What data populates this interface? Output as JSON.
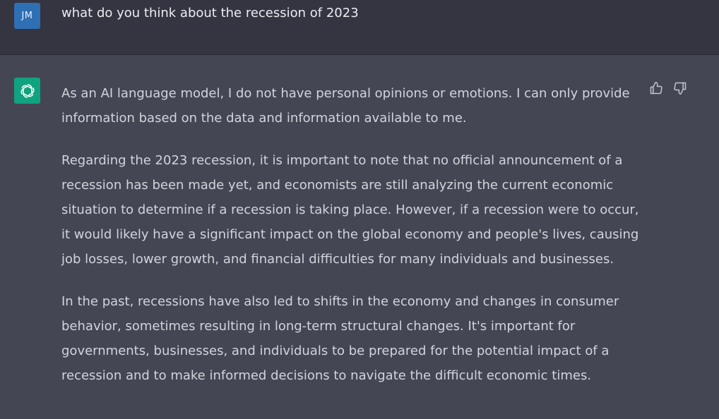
{
  "user_message": {
    "avatar_initials": "JM",
    "avatar_color": "#2f6fb3",
    "text": "what do you think about the recession of 2023"
  },
  "assistant_message": {
    "avatar_icon": "openai-logo-icon",
    "avatar_color": "#10a37f",
    "paragraphs": [
      "As an AI language model, I do not have personal opinions or emotions. I can only provide information based on the data and information available to me.",
      "Regarding the 2023 recession, it is important to note that no official announcement of a recession has been made yet, and economists are still analyzing the current economic situation to determine if a recession is taking place. However, if a recession were to occur, it would likely have a significant impact on the global economy and people's lives, causing job losses, lower growth, and financial difficulties for many individuals and businesses.",
      "In the past, recessions have also led to shifts in the economy and changes in consumer behavior, sometimes resulting in long-term structural changes. It's important for governments, businesses, and individuals to be prepared for the potential impact of a recession and to make informed decisions to navigate the difficult economic times."
    ],
    "feedback_icons": [
      "thumbs-up-icon",
      "thumbs-down-icon"
    ]
  },
  "colors": {
    "user_bg": "#343541",
    "assistant_bg": "#444654",
    "text": "#d1d5db"
  }
}
